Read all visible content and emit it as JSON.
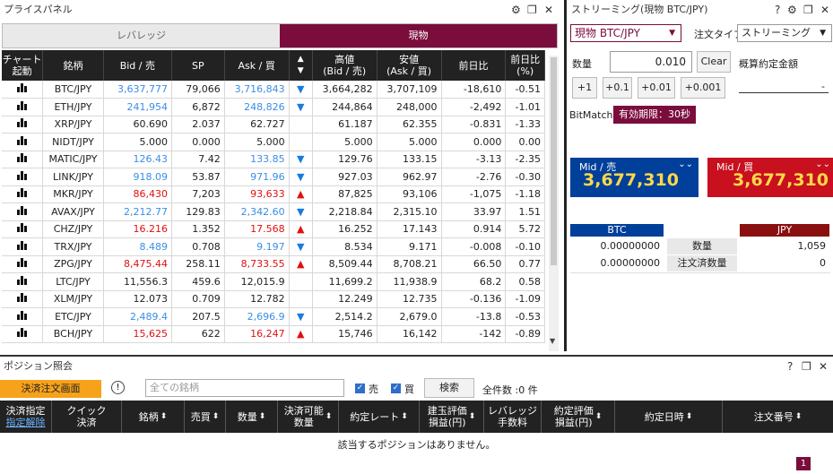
{
  "price_panel": {
    "title": "プライスパネル",
    "tabs": [
      {
        "label": "レバレッジ",
        "active": false
      },
      {
        "label": "現物",
        "active": true
      }
    ],
    "headers": [
      "チャート\n起動",
      "銘柄",
      "Bid / 売",
      "SP",
      "Ask / 買",
      "▲\n▼",
      "高値\n(Bid / 売)",
      "安値\n(Ask / 買)",
      "前日比",
      "前日比\n(%)"
    ],
    "rows": [
      {
        "symbol": "BTC/JPY",
        "bid": "3,637,777",
        "sp": "79,066",
        "ask": "3,716,843",
        "dir": "down",
        "high": "3,664,282",
        "low": "3,707,109",
        "chg": "-18,610",
        "pct": "-0.51",
        "color": "blue"
      },
      {
        "symbol": "ETH/JPY",
        "bid": "241,954",
        "sp": "6,872",
        "ask": "248,826",
        "dir": "down",
        "high": "244,864",
        "low": "248,000",
        "chg": "-2,492",
        "pct": "-1.01",
        "color": "blue"
      },
      {
        "symbol": "XRP/JPY",
        "bid": "60.690",
        "sp": "2.037",
        "ask": "62.727",
        "dir": "",
        "high": "61.187",
        "low": "62.355",
        "chg": "-0.831",
        "pct": "-1.33",
        "color": "black"
      },
      {
        "symbol": "NIDT/JPY",
        "bid": "5.000",
        "sp": "0.000",
        "ask": "5.000",
        "dir": "",
        "high": "5.000",
        "low": "5.000",
        "chg": "0.000",
        "pct": "0.00",
        "color": "black"
      },
      {
        "symbol": "MATIC/JPY",
        "bid": "126.43",
        "sp": "7.42",
        "ask": "133.85",
        "dir": "down",
        "high": "129.76",
        "low": "133.15",
        "chg": "-3.13",
        "pct": "-2.35",
        "color": "blue"
      },
      {
        "symbol": "LINK/JPY",
        "bid": "918.09",
        "sp": "53.87",
        "ask": "971.96",
        "dir": "down",
        "high": "927.03",
        "low": "962.97",
        "chg": "-2.76",
        "pct": "-0.30",
        "color": "blue"
      },
      {
        "symbol": "MKR/JPY",
        "bid": "86,430",
        "sp": "7,203",
        "ask": "93,633",
        "dir": "up",
        "high": "87,825",
        "low": "93,106",
        "chg": "-1,075",
        "pct": "-1.18",
        "color": "red"
      },
      {
        "symbol": "AVAX/JPY",
        "bid": "2,212.77",
        "sp": "129.83",
        "ask": "2,342.60",
        "dir": "down",
        "high": "2,218.84",
        "low": "2,315.10",
        "chg": "33.97",
        "pct": "1.51",
        "color": "blue"
      },
      {
        "symbol": "CHZ/JPY",
        "bid": "16.216",
        "sp": "1.352",
        "ask": "17.568",
        "dir": "up",
        "high": "16.252",
        "low": "17.143",
        "chg": "0.914",
        "pct": "5.72",
        "color": "red"
      },
      {
        "symbol": "TRX/JPY",
        "bid": "8.489",
        "sp": "0.708",
        "ask": "9.197",
        "dir": "down",
        "high": "8.534",
        "low": "9.171",
        "chg": "-0.008",
        "pct": "-0.10",
        "color": "blue"
      },
      {
        "symbol": "ZPG/JPY",
        "bid": "8,475.44",
        "sp": "258.11",
        "ask": "8,733.55",
        "dir": "up",
        "high": "8,509.44",
        "low": "8,708.21",
        "chg": "66.50",
        "pct": "0.77",
        "color": "red"
      },
      {
        "symbol": "LTC/JPY",
        "bid": "11,556.3",
        "sp": "459.6",
        "ask": "12,015.9",
        "dir": "",
        "high": "11,699.2",
        "low": "11,938.9",
        "chg": "68.2",
        "pct": "0.58",
        "color": "black"
      },
      {
        "symbol": "XLM/JPY",
        "bid": "12.073",
        "sp": "0.709",
        "ask": "12.782",
        "dir": "",
        "high": "12.249",
        "low": "12.735",
        "chg": "-0.136",
        "pct": "-1.09",
        "color": "black"
      },
      {
        "symbol": "ETC/JPY",
        "bid": "2,489.4",
        "sp": "207.5",
        "ask": "2,696.9",
        "dir": "down",
        "high": "2,514.2",
        "low": "2,679.0",
        "chg": "-13.8",
        "pct": "-0.53",
        "color": "blue"
      },
      {
        "symbol": "BCH/JPY",
        "bid": "15,625",
        "sp": "622",
        "ask": "16,247",
        "dir": "up",
        "high": "15,746",
        "low": "16,142",
        "chg": "-142",
        "pct": "-0.89",
        "color": "red"
      }
    ]
  },
  "stream_panel": {
    "title": "ストリーミング(現物 BTC/JPY)",
    "symbol_select": "現物 BTC/JPY",
    "order_type_label": "注文タイプ",
    "order_type_value": "ストリーミング",
    "qty_label": "数量",
    "qty_value": "0.010",
    "clear_label": "Clear",
    "approx_label": "概算約定金額",
    "approx_value": "-",
    "increments": [
      "+1",
      "+0.1",
      "+0.01",
      "+0.001"
    ],
    "bitmatch_label": "BitMatch",
    "validity_label": "有効期限：30秒",
    "mid_sell_label": "Mid / 売",
    "mid_sell_value": "3,677,310",
    "mid_buy_label": "Mid / 買",
    "mid_buy_value": "3,677,310",
    "btc_header": "BTC",
    "jpy_header": "JPY",
    "qty_row_label": "数量",
    "qty_btc": "0.00000000",
    "qty_jpy": "1,059",
    "ordered_row_label": "注文済数量",
    "ordered_btc": "0.00000000",
    "ordered_jpy": "0"
  },
  "position_panel": {
    "title": "ポジション照会",
    "settle_button": "決済注文画面",
    "search_placeholder": "全ての銘柄",
    "sell_label": "売",
    "buy_label": "買",
    "search_button": "検索",
    "count_text": "全件数 :0 件",
    "columns": [
      "決済指定",
      "クイック\n決済",
      "銘柄",
      "売買",
      "数量",
      "決済可能\n数量",
      "約定レート",
      "建玉評価\n損益(円)",
      "レバレッジ\n手数料",
      "約定評価\n損益(円)",
      "約定日時",
      "注文番号"
    ],
    "cancel_link": "指定解除",
    "empty_text": "該当するポジションはありません。",
    "page": "1"
  },
  "colors": {
    "accent": "#7a0d3c",
    "sell_blue": "#003f9a",
    "buy_red": "#c8101e",
    "orange": "#f7a21b"
  }
}
